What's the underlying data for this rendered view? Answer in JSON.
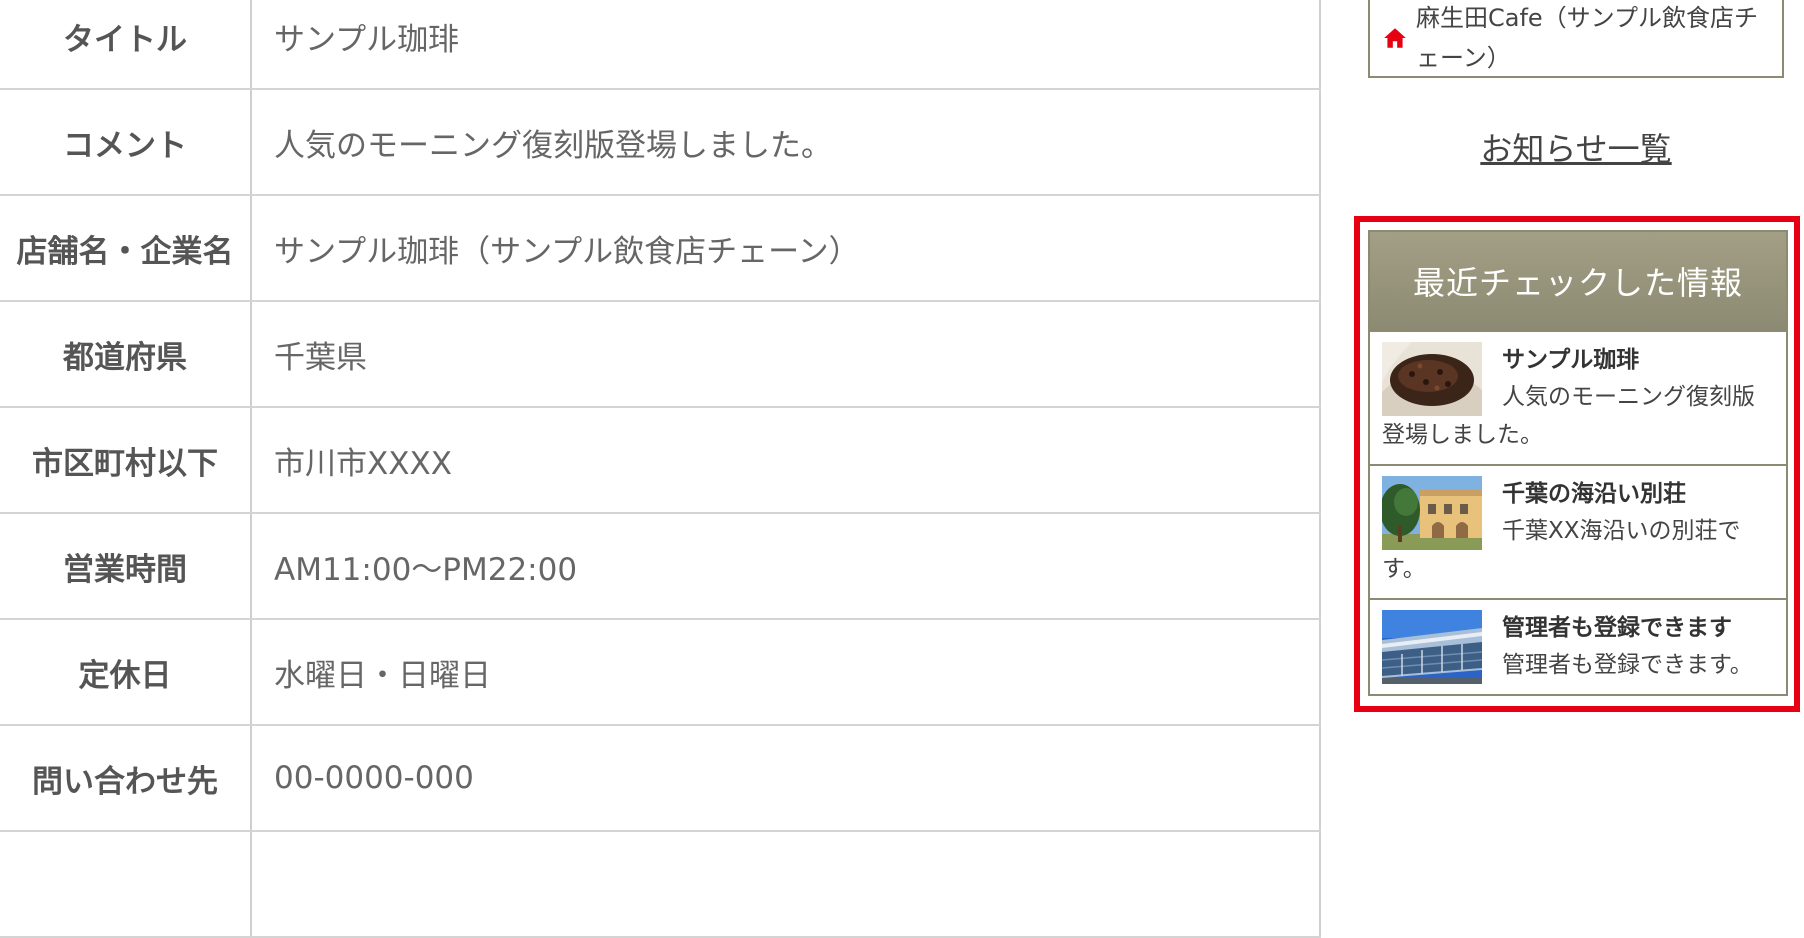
{
  "details": [
    {
      "label": "タイトル",
      "value": "サンプル珈琲"
    },
    {
      "label": "コメント",
      "value": "人気のモーニング復刻版登場しました。"
    },
    {
      "label": "店舗名・企業名",
      "value": "サンプル珈琲（サンプル飲食店チェーン）"
    },
    {
      "label": "都道府県",
      "value": "千葉県"
    },
    {
      "label": "市区町村以下",
      "value": "市川市XXXX"
    },
    {
      "label": "営業時間",
      "value": "AM11:00〜PM22:00"
    },
    {
      "label": "定休日",
      "value": "水曜日・日曜日"
    },
    {
      "label": "問い合わせ先",
      "value": "00-0000-000"
    }
  ],
  "sidebar": {
    "shop_link": "麻生田Cafe（サンプル飲食店チェーン）",
    "home_icon": "home-icon",
    "home_icon_color": "#e60012",
    "notice_link": "お知らせ一覧",
    "recent": {
      "heading": "最近チェックした情報",
      "highlight_color": "#e60012",
      "items": [
        {
          "title": "サンプル珈琲",
          "desc": "人気のモーニング復刻版登場しました。",
          "thumb": "coffee-beans"
        },
        {
          "title": "千葉の海沿い別荘",
          "desc": "千葉XX海沿いの別荘です。",
          "thumb": "villa"
        },
        {
          "title": "管理者も登録できます",
          "desc": "管理者も登録できます。",
          "thumb": "building"
        }
      ]
    }
  }
}
